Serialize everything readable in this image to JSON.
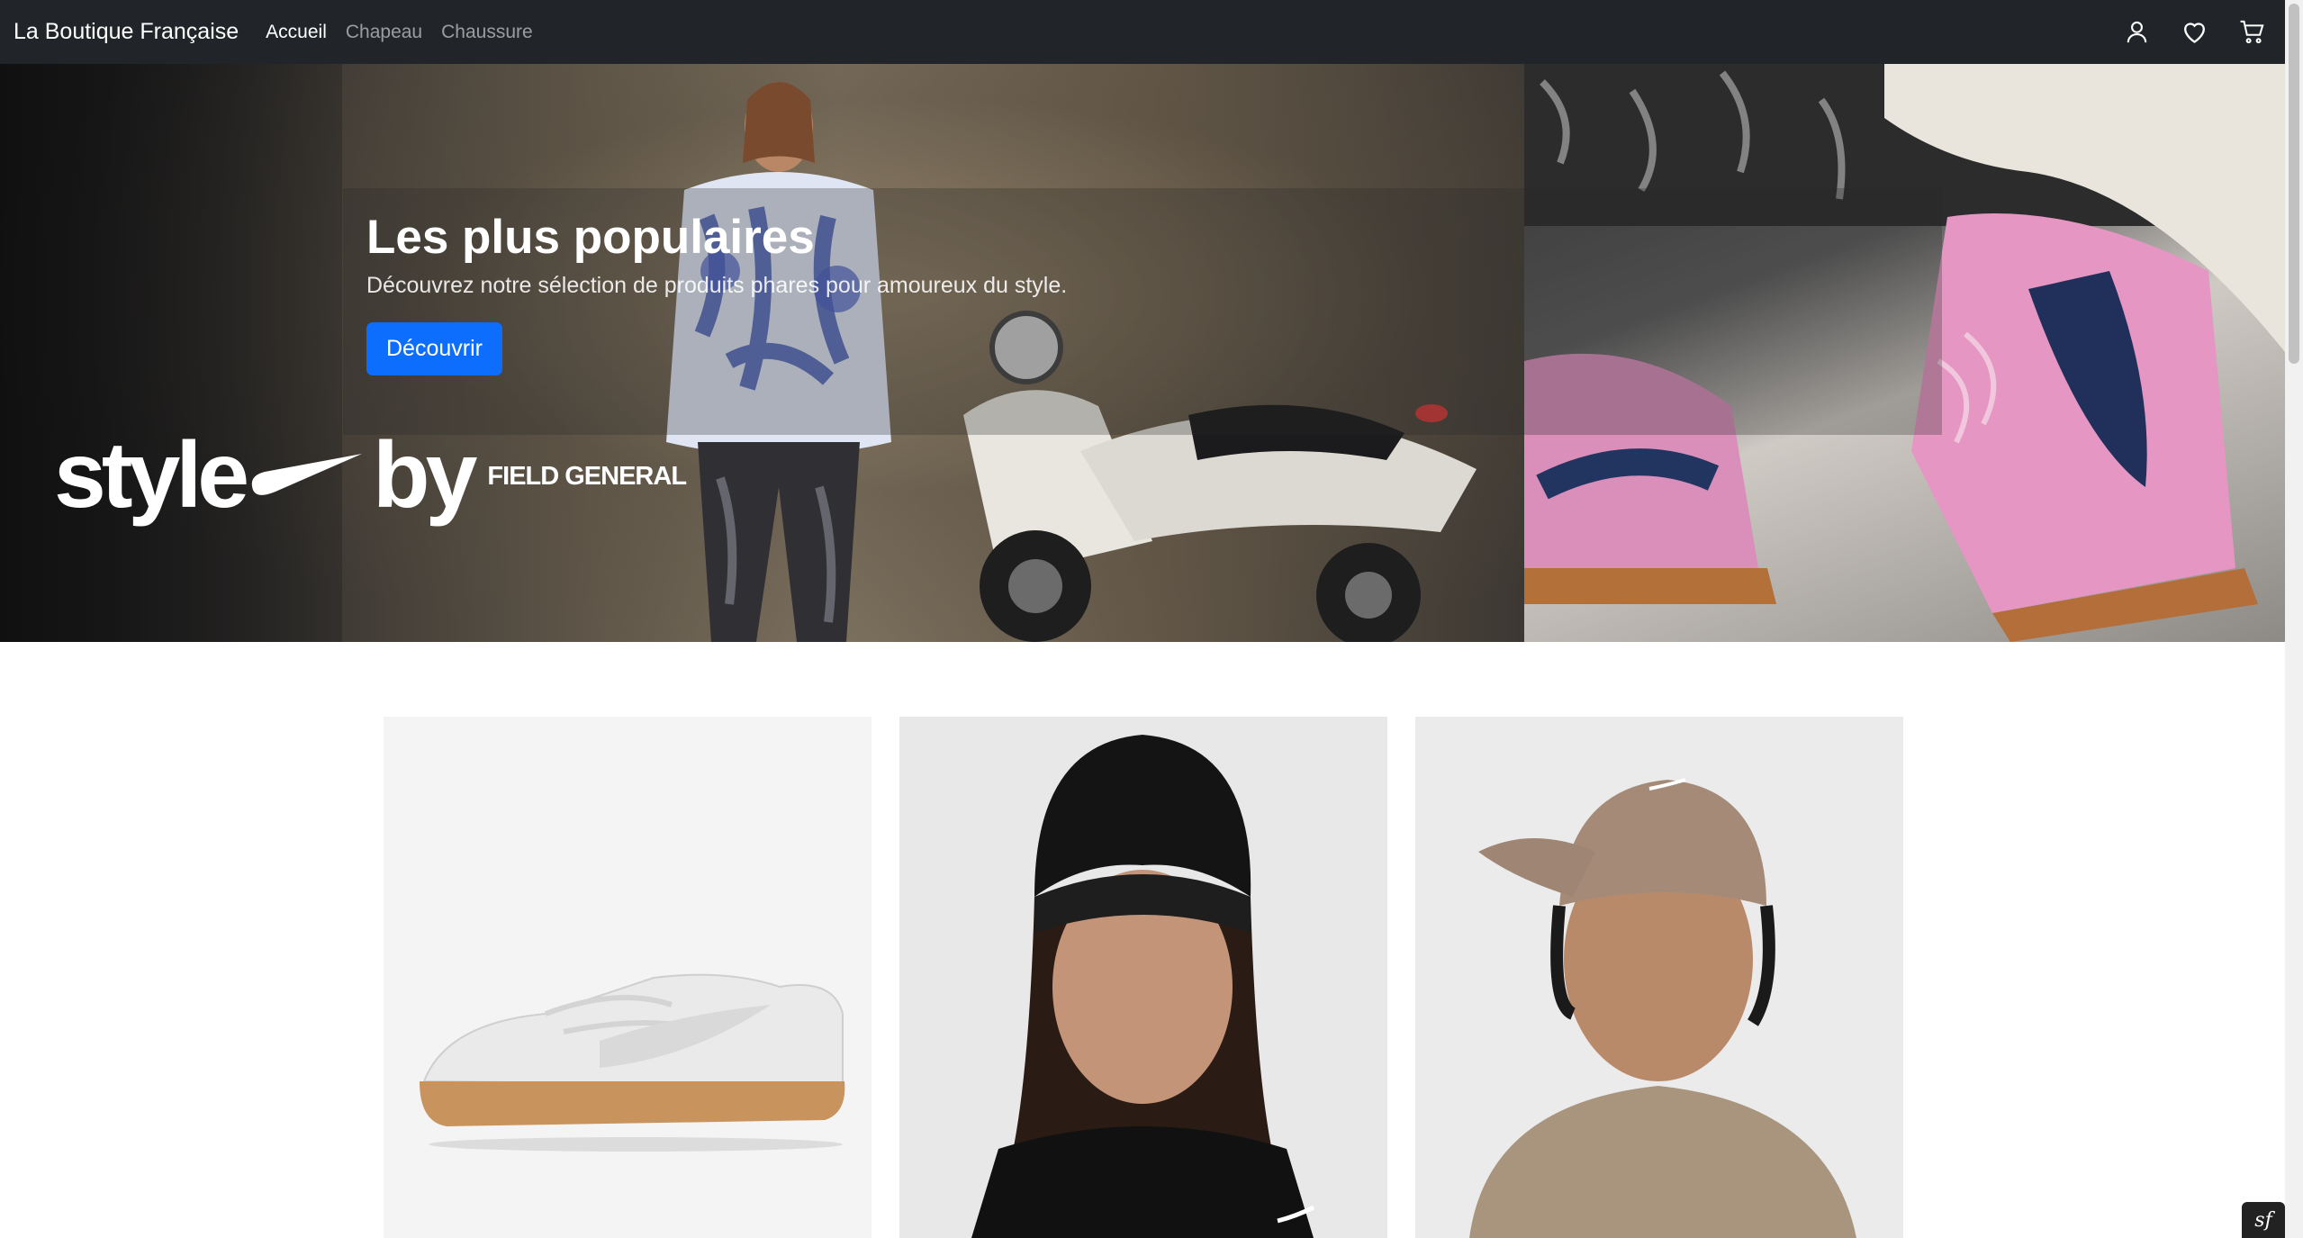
{
  "navbar": {
    "brand": "La Boutique Française",
    "links": [
      {
        "label": "Accueil",
        "active": true
      },
      {
        "label": "Chapeau",
        "active": false
      },
      {
        "label": "Chaussure",
        "active": false
      }
    ],
    "icons": [
      "user-icon",
      "heart-icon",
      "cart-icon"
    ]
  },
  "hero": {
    "title": "Les plus populaires",
    "subtitle": "Découvrez notre sélection de produits phares pour amoureux du style.",
    "button_label": "Découvrir",
    "logo": {
      "word1": "style",
      "word2": "by",
      "field": "FIELD GENERAL"
    }
  },
  "products": [
    {
      "image": "white-sneaker-gum-sole"
    },
    {
      "image": "woman-black-beanie"
    },
    {
      "image": "man-tan-cap"
    }
  ],
  "colors": {
    "navbar_bg": "#212529",
    "primary": "#0d6efd",
    "card_bg": "#f3f3f3"
  }
}
